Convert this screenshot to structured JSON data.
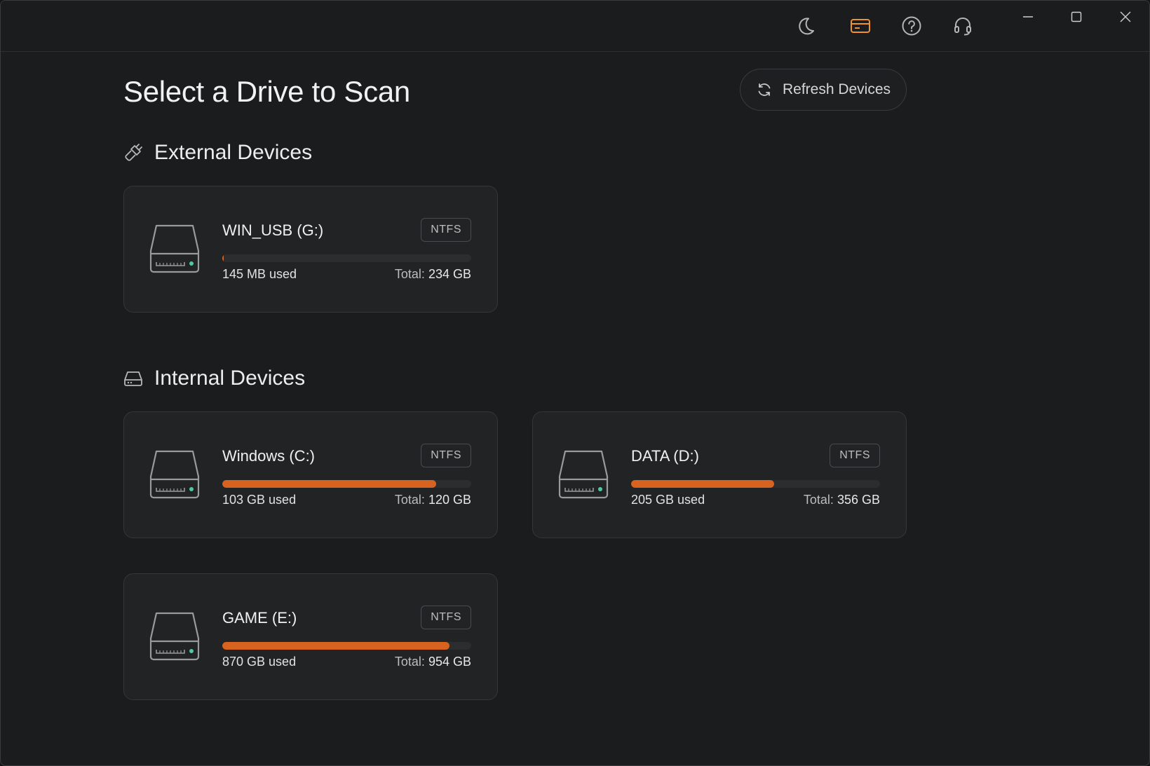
{
  "window": {
    "toolbar_icons": [
      "moon-icon",
      "card-icon",
      "help-icon",
      "headset-icon"
    ],
    "controls": [
      "minimize-icon",
      "maximize-icon",
      "close-icon"
    ]
  },
  "page": {
    "title": "Select a Drive to Scan",
    "refresh_label": "Refresh Devices"
  },
  "colors": {
    "accent": "#d8621f",
    "card_icon_accent": "#f0922e",
    "background": "#1b1c1e",
    "card": "#222325"
  },
  "external": {
    "heading": "External Devices",
    "drives": [
      {
        "name": "WIN_USB (G:)",
        "fs": "NTFS",
        "used": "145 MB used",
        "total_label": "Total:",
        "total": "234 GB",
        "usage": 0.0006
      }
    ]
  },
  "internal": {
    "heading": "Internal Devices",
    "drives": [
      {
        "name": "Windows (C:)",
        "fs": "NTFS",
        "used": "103 GB used",
        "total_label": "Total:",
        "total": "120 GB",
        "usage": 0.8583
      },
      {
        "name": "DATA (D:)",
        "fs": "NTFS",
        "used": "205 GB used",
        "total_label": "Total:",
        "total": "356 GB",
        "usage": 0.5758
      },
      {
        "name": "GAME (E:)",
        "fs": "NTFS",
        "used": "870 GB used",
        "total_label": "Total:",
        "total": "954 GB",
        "usage": 0.9119
      }
    ]
  }
}
